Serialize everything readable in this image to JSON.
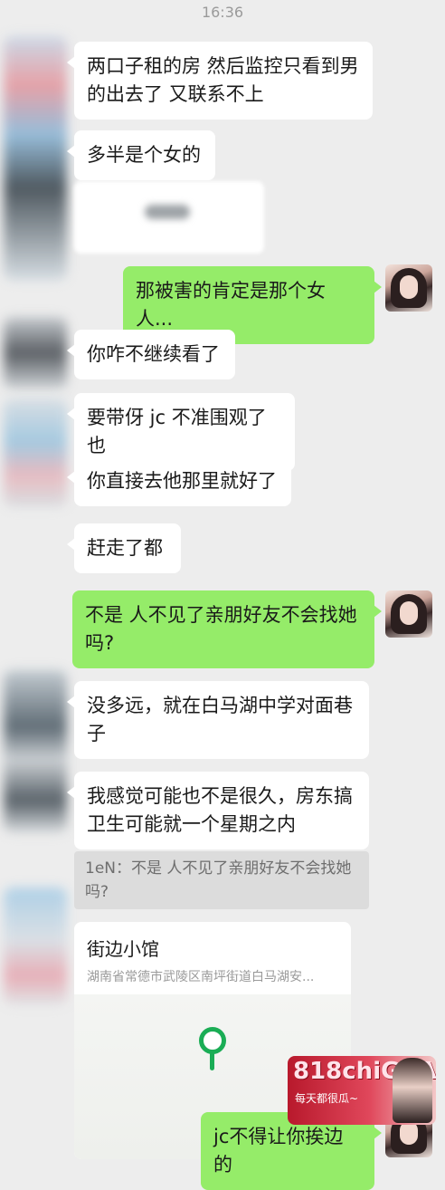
{
  "status_time": "16:36",
  "messages": {
    "m1": "两口子租的房 然后监控只看到男\n的出去了 又联系不上",
    "m2": "多半是个女的",
    "m3": "那被害的肯定是那个女人...",
    "m4": "你咋不继续看了",
    "m5": "要带伢 jc 不准围观了也",
    "m6": "你直接去他那里就好了",
    "m7": "赶走了都",
    "m8": "不是 人不见了亲朋好友不会找她\n吗?",
    "m9": "没多远，就在白马湖中学对面巷\n子",
    "m10": "我感觉可能也不是很久，房东搞\n卫生可能就一个星期之内",
    "m11": "jc不得让你挨边的"
  },
  "quote": {
    "text": "1eN：不是 人不见了亲朋好友不会找她\n吗?"
  },
  "location_card": {
    "name": "街边小馆",
    "address": "湖南省常德市武陵区南坪街道白马湖安..."
  },
  "watermark": {
    "logo": "818chiGUA",
    "tagline": "每天都很瓜~"
  },
  "colors": {
    "background": "#ededed",
    "outgoing_bubble": "#95ec69",
    "incoming_bubble": "#ffffff",
    "pin": "#1aad55"
  }
}
